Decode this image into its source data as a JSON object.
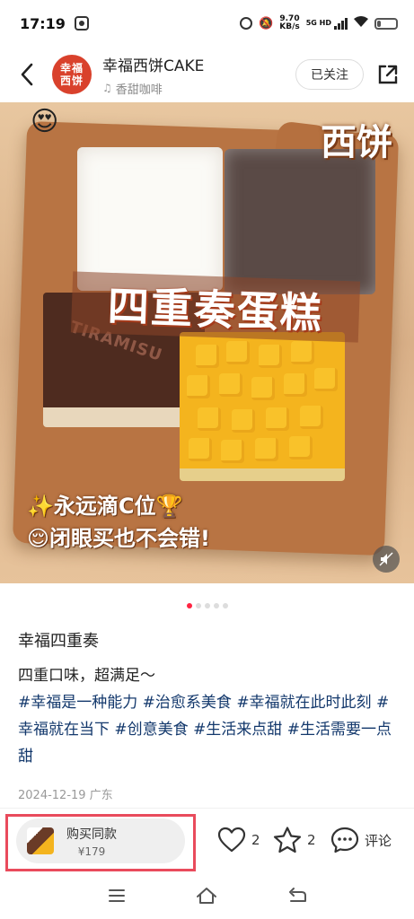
{
  "status_bar": {
    "time": "17:19",
    "speed_value": "9.70",
    "speed_unit": "KB/s",
    "network": "5G HD"
  },
  "header": {
    "author_name": "幸福西饼CAKE",
    "avatar_text": "幸福西饼",
    "music_label": "香甜咖啡",
    "follow_label": "已关注"
  },
  "media": {
    "corner_label": "西饼",
    "overlay_title": "四重奏蛋糕",
    "caption_1": "✨永远滴C位🏆",
    "caption_2": "😌闭眼买也不会错!",
    "cake_mark": "TIRAMISU",
    "emoji_deco": "😍",
    "page_count": 5,
    "active_page": 1
  },
  "note": {
    "title": "幸福四重奏",
    "body": "四重口味，超满足～",
    "tags": [
      "#幸福是一种能力",
      "#治愈系美食",
      "#幸福就在此时此刻",
      "#幸福就在当下",
      "#创意美食",
      "#生活来点甜",
      "#生活需要一点甜"
    ],
    "date": "2024-12-19 广东"
  },
  "bottom_bar": {
    "buy_label": "购买同款",
    "buy_price": "¥179",
    "like_count": "2",
    "fav_count": "2",
    "comment_label": "评论"
  },
  "colors": {
    "accent": "#ff2442",
    "tag": "#13386c",
    "highlight": "#e94b5c"
  },
  "icons": [
    "back-icon",
    "music-icon",
    "share-icon",
    "mute-icon",
    "heart-icon",
    "star-icon",
    "comment-icon",
    "menu-icon",
    "home-icon",
    "return-icon"
  ]
}
